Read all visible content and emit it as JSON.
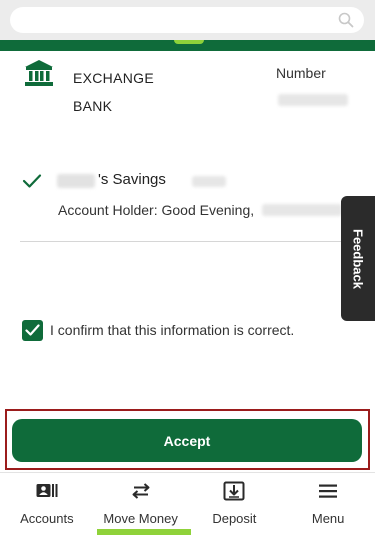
{
  "bank": {
    "name": "EXCHANGE BANK",
    "icon": "bank-building-icon"
  },
  "number": {
    "label": "Number",
    "value": "•••••••"
  },
  "account": {
    "title": "'s Savings",
    "holder": "Account Holder: Good Evening,",
    "selected_icon": "checkmark-icon"
  },
  "feedback": {
    "label": "Feedback"
  },
  "confirm": {
    "label": "I confirm that this information is correct.",
    "checked": true
  },
  "accept": {
    "label": "Accept"
  },
  "bottom_nav": {
    "items": [
      {
        "label": "Accounts",
        "icon": "accounts-card-icon"
      },
      {
        "label": "Move Money",
        "icon": "transfer-arrows-icon"
      },
      {
        "label": "Deposit",
        "icon": "deposit-tray-icon"
      },
      {
        "label": "Menu",
        "icon": "hamburger-menu-icon"
      }
    ],
    "active_index": 1
  },
  "colors": {
    "primary_green": "#0f6b3a",
    "accent_lime": "#8fd23a",
    "highlight_red": "#9b1c1c",
    "feedback_dark": "#2b2b2b"
  }
}
